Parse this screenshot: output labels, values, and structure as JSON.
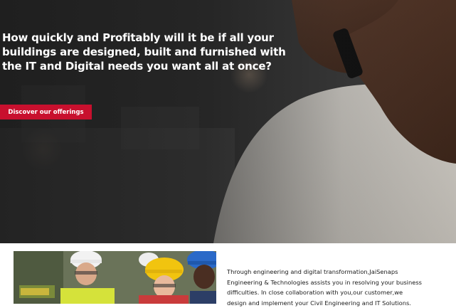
{
  "hero": {
    "headline": "How quickly and Profitably will it be if all your buildings are designed, built and furnished with the IT and Digital needs you want all at once?",
    "cta_label": "Discover our offerings",
    "accent_color": "#c8102e",
    "image_icon": "man-on-phone-photo"
  },
  "about": {
    "image_icon": "engineers-with-hard-hats-photo",
    "text": "Through engineering and digital transformation,JaiSenaps\nEngineering & Technologies assists you in resolving your business\ndifficulties. In close collaboration with you,our customer,we\ndesign and implement your Civil Engineering and IT Solutions."
  }
}
